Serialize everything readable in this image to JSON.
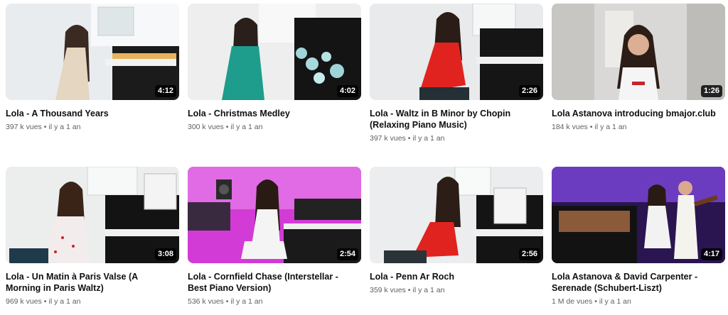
{
  "videos": [
    {
      "title": "Lola - A Thousand Years",
      "duration": "4:12",
      "views": "397 k vues",
      "age": "il y a 1 an"
    },
    {
      "title": "Lola - Christmas Medley",
      "duration": "4:02",
      "views": "300 k vues",
      "age": "il y a 1 an"
    },
    {
      "title": "Lola - Waltz in B Minor by Chopin (Relaxing Piano Music)",
      "duration": "2:26",
      "views": "397 k vues",
      "age": "il y a 1 an"
    },
    {
      "title": "Lola Astanova introducing bmajor.club",
      "duration": "1:26",
      "views": "184 k vues",
      "age": "il y a 1 an"
    },
    {
      "title": "Lola - Un Matin à Paris Valse (A Morning in Paris Waltz)",
      "duration": "3:08",
      "views": "969 k vues",
      "age": "il y a 1 an"
    },
    {
      "title": "Lola - Cornfield Chase (Interstellar - Best Piano Version)",
      "duration": "2:54",
      "views": "536 k vues",
      "age": "il y a 1 an"
    },
    {
      "title": "Lola - Penn Ar Roch",
      "duration": "2:56",
      "views": "359 k vues",
      "age": "il y a 1 an"
    },
    {
      "title": "Lola Astanova & David Carpenter - Serenade (Schubert-Liszt)",
      "duration": "4:17",
      "views": "1 M de vues",
      "age": "il y a 1 an"
    }
  ],
  "separator": "•",
  "colors": {
    "meta_text": "#606060",
    "title_text": "#0f0f0f",
    "duration_bg": "#000000"
  }
}
